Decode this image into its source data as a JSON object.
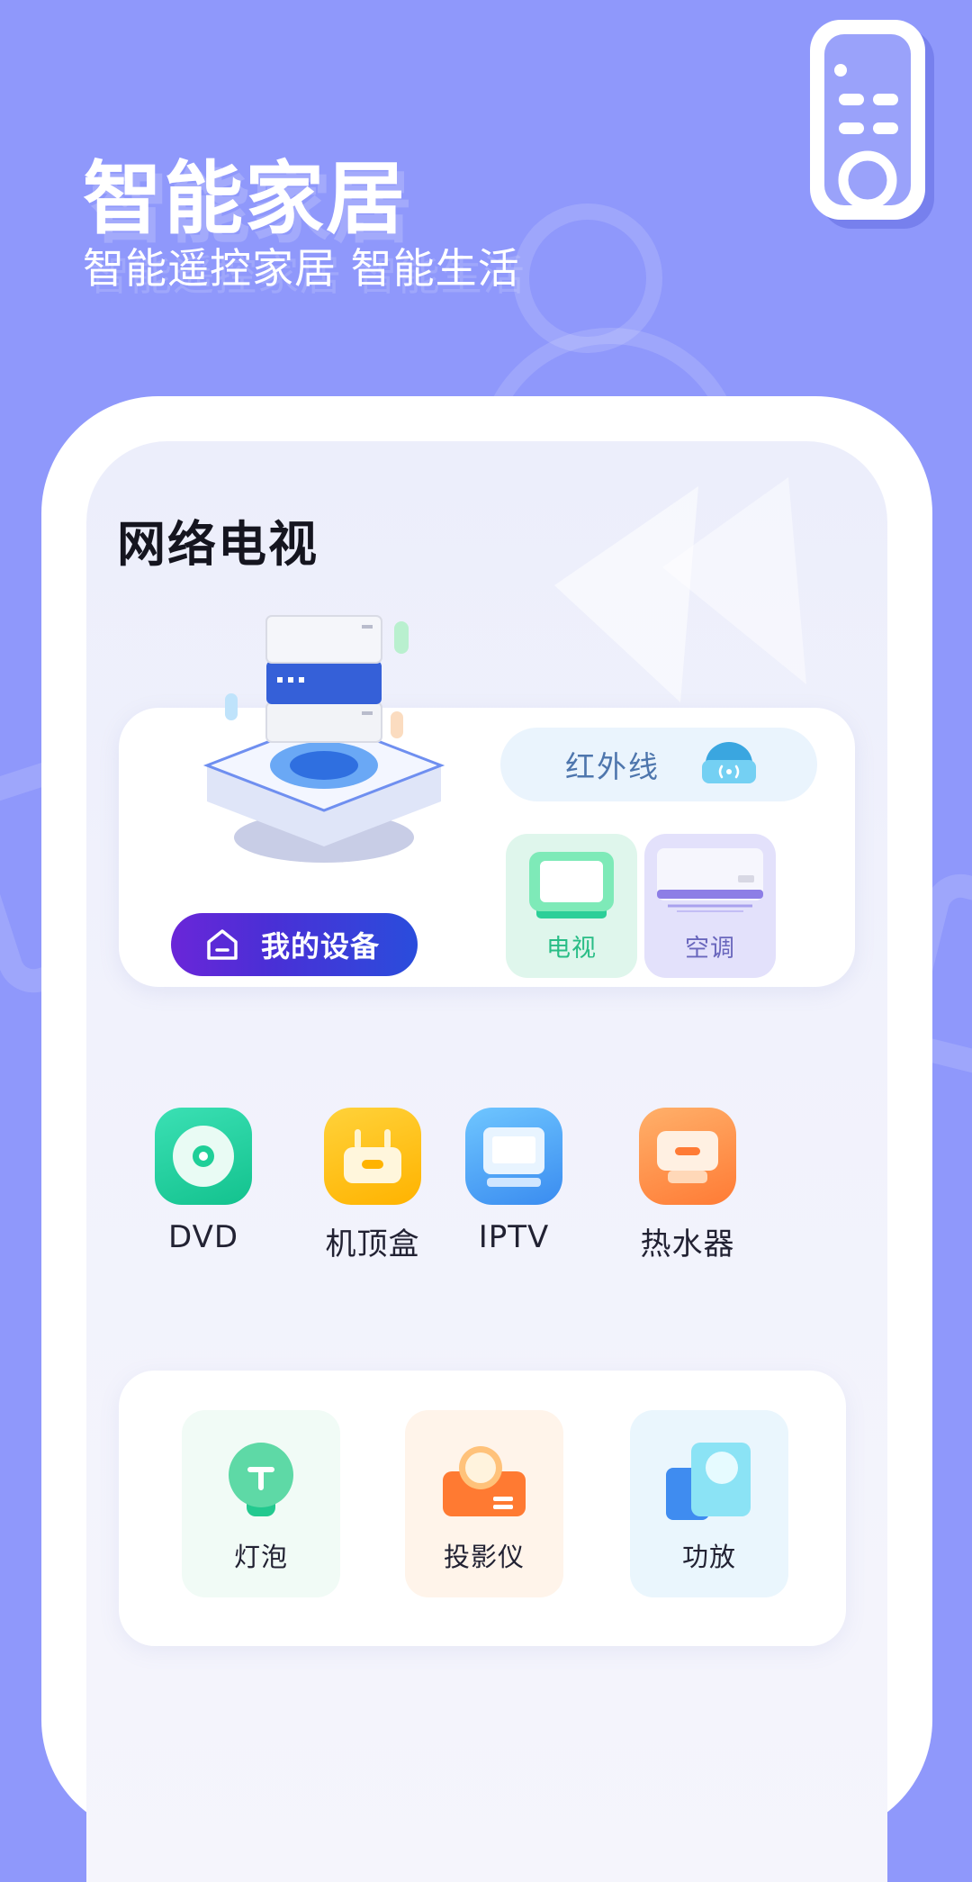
{
  "hero": {
    "title": "智能家居",
    "subtitle": "智能遥控家居  智能生活"
  },
  "logo_icon": "remote-control-icon",
  "screen": {
    "title": "网络电视",
    "my_device_button": "我的设备",
    "infrared_label": "红外线",
    "tiles": [
      {
        "label": "电视",
        "icon": "tv-icon"
      },
      {
        "label": "空调",
        "icon": "air-conditioner-icon"
      }
    ],
    "apps": [
      {
        "label": "DVD",
        "icon": "dvd-disc-icon"
      },
      {
        "label": "机顶盒",
        "icon": "set-top-box-icon"
      },
      {
        "label": "IPTV",
        "icon": "iptv-icon"
      },
      {
        "label": "热水器",
        "icon": "water-heater-icon"
      }
    ],
    "bottom": [
      {
        "label": "灯泡",
        "icon": "light-bulb-icon"
      },
      {
        "label": "投影仪",
        "icon": "projector-icon"
      },
      {
        "label": "功放",
        "icon": "amplifier-icon"
      }
    ]
  },
  "colors": {
    "background": "#8f98fb",
    "accent_purple": "#6a26d8",
    "accent_blue": "#2a4ddc",
    "tv_green": "#29bd86",
    "ac_purple": "#6a67bd"
  }
}
